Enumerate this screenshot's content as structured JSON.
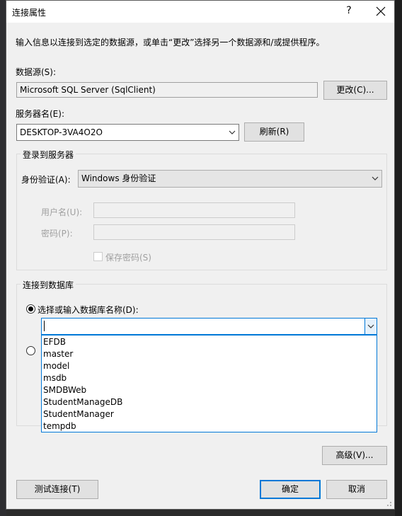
{
  "dialog": {
    "title": "连接属性",
    "help_glyph": "?",
    "intro": "输入信息以连接到选定的数据源，或单击“更改”选择另一个数据源和/或提供程序。"
  },
  "datasource": {
    "label": "数据源(S):",
    "value": "Microsoft SQL Server (SqlClient)",
    "change_button": "更改(C)..."
  },
  "server": {
    "label": "服务器名(E):",
    "value": "DESKTOP-3VA4O2O",
    "refresh_button": "刷新(R)"
  },
  "login_group": {
    "title": "登录到服务器",
    "auth_label": "身份验证(A):",
    "auth_value": "Windows 身份验证",
    "username_label": "用户名(U):",
    "password_label": "密码(P):",
    "save_password_label": "保存密码(S)"
  },
  "database_group": {
    "title": "连接到数据库",
    "select_radio_label": "选择或输入数据库名称(D):",
    "database_input_value": "",
    "databases": [
      "EFDB",
      "master",
      "model",
      "msdb",
      "SMDBWeb",
      "StudentManageDB",
      "StudentManager",
      "tempdb"
    ]
  },
  "buttons": {
    "advanced": "高级(V)...",
    "test_connection": "测试连接(T)",
    "ok": "确定",
    "cancel": "取消"
  },
  "colors": {
    "focus_blue": "#0078d7",
    "dialog_bg": "#f0f0f0",
    "button_bg": "#e1e1e1"
  }
}
